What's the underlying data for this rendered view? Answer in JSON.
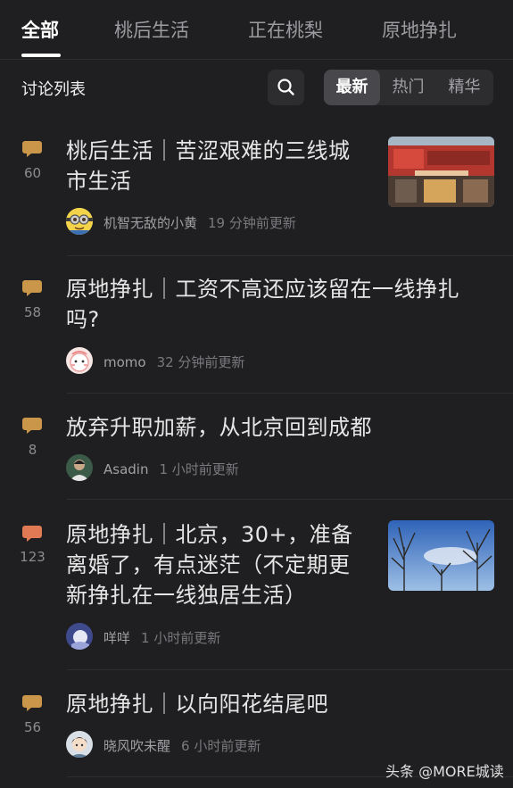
{
  "tabs": [
    "全部",
    "桃后生活",
    "正在桃梨",
    "原地挣扎"
  ],
  "toolbar": {
    "title": "讨论列表",
    "sort_options": [
      "最新",
      "热门",
      "精华"
    ],
    "active_sort": "最新"
  },
  "colors": {
    "background": "#1f1f21",
    "comment_icon_hot": "#e07a55",
    "comment_icon_normal": "#c9964a",
    "text_primary": "#e6e6e6",
    "text_secondary": "#a0a0a4"
  },
  "posts": [
    {
      "comments": "60",
      "title_lines": [
        "桃后生活｜苦涩艰难的三线城",
        "市生活"
      ],
      "author": "机智无敌的小黄",
      "time": "19 分钟前更新",
      "has_thumbnail": true,
      "thumbnail": "storefront-photo",
      "icon_color": "#c9964a"
    },
    {
      "comments": "58",
      "title_lines": [
        "原地挣扎｜工资不高还应该留在一线挣扎",
        "吗?"
      ],
      "author": "momo",
      "time": "32 分钟前更新",
      "has_thumbnail": false,
      "icon_color": "#c9964a"
    },
    {
      "comments": "8",
      "title_lines": [
        "放弃升职加薪，从北京回到成都"
      ],
      "author": "Asadin",
      "time": "1 小时前更新",
      "has_thumbnail": false,
      "icon_color": "#c9964a"
    },
    {
      "comments": "123",
      "title_lines": [
        "原地挣扎｜北京，30+，准备",
        "离婚了，有点迷茫（不定期更",
        "新挣扎在一线独居生活）"
      ],
      "author": "咩咩",
      "time": "1 小时前更新",
      "has_thumbnail": true,
      "thumbnail": "bare-trees-sky-photo",
      "icon_color": "#e07a55"
    },
    {
      "comments": "56",
      "title_lines": [
        "原地挣扎｜以向阳花结尾吧"
      ],
      "author": "晓风吹未醒",
      "time": "6 小时前更新",
      "has_thumbnail": false,
      "icon_color": "#c9964a"
    }
  ],
  "watermark": "头条 @MORE城读"
}
